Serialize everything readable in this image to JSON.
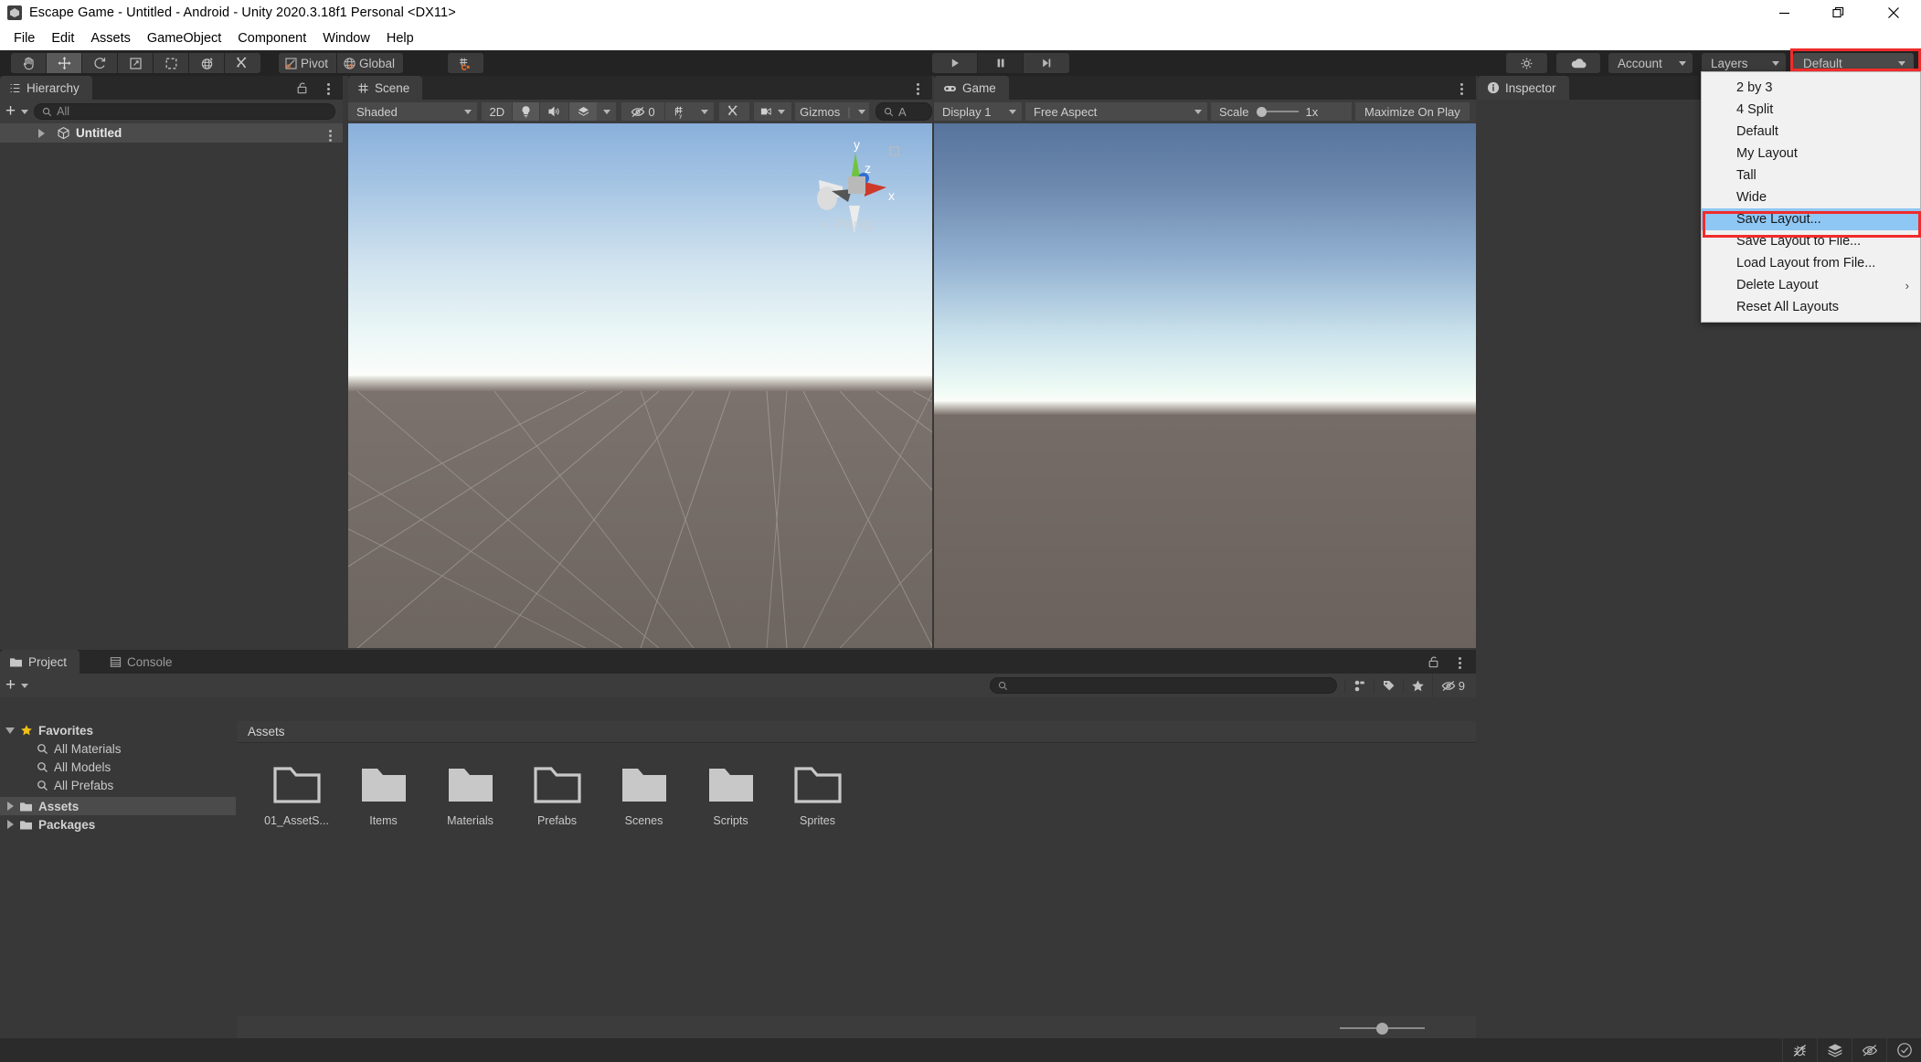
{
  "window": {
    "title": "Escape Game - Untitled - Android - Unity 2020.3.18f1 Personal <DX11>",
    "minimize": "minimize",
    "restore": "restore",
    "close": "close"
  },
  "menubar": {
    "items": [
      "File",
      "Edit",
      "Assets",
      "GameObject",
      "Component",
      "Window",
      "Help"
    ]
  },
  "toolbar": {
    "transform_tools": [
      "hand-tool",
      "move-tool",
      "rotate-tool",
      "scale-tool",
      "rect-tool",
      "transform-tool",
      "custom-tool"
    ],
    "pivot_label": "Pivot",
    "global_label": "Global",
    "snap_label": "grid-snap",
    "play_label": "play",
    "pause_label": "pause",
    "step_label": "step",
    "collab_label": "collab",
    "cloud_label": "cloud",
    "account_label": "Account",
    "layers_label": "Layers",
    "layout_label": "Default"
  },
  "hierarchy": {
    "tab": "Hierarchy",
    "search_placeholder": "All",
    "add_label": "+",
    "lock_label": "lock",
    "rows": [
      {
        "label": "Untitled",
        "icon": "unity-scene-icon"
      }
    ]
  },
  "scene": {
    "tab": "Scene",
    "shading_mode": "Shaded",
    "mode_2d": "2D",
    "lighting": "lighting-toggle",
    "audio": "audio-toggle",
    "fx": "effects-toggle",
    "hidden_count": "0",
    "grid": "grid-visibility",
    "tools": "scene-tools",
    "camera": "scene-camera",
    "gizmos_label": "Gizmos",
    "search_placeholder": "A",
    "gizmo": {
      "x": "x",
      "y": "y",
      "z": "z",
      "persp": "Persp"
    }
  },
  "game": {
    "tab": "Game",
    "display": "Display 1",
    "aspect": "Free Aspect",
    "scale_label": "Scale",
    "scale_value": "1x",
    "maximize_label": "Maximize On Play"
  },
  "inspector": {
    "tab": "Inspector"
  },
  "project": {
    "tab": "Project",
    "console_tab": "Console",
    "add_label": "+",
    "search_placeholder": "",
    "hidden_count": "9",
    "tree": [
      {
        "label": "Favorites",
        "type": "favorites",
        "expanded": true
      },
      {
        "label": "All Materials",
        "type": "search"
      },
      {
        "label": "All Models",
        "type": "search"
      },
      {
        "label": "All Prefabs",
        "type": "search"
      },
      {
        "label": "Assets",
        "type": "folder",
        "selected": true
      },
      {
        "label": "Packages",
        "type": "folder"
      }
    ],
    "breadcrumb": "Assets",
    "folders": [
      "01_AssetS...",
      "Items",
      "Materials",
      "Prefabs",
      "Scenes",
      "Scripts",
      "Sprites"
    ]
  },
  "layout_menu": {
    "items": [
      {
        "label": "2 by 3"
      },
      {
        "label": "4 Split"
      },
      {
        "label": "Default"
      },
      {
        "label": "My Layout"
      },
      {
        "label": "Tall"
      },
      {
        "label": "Wide"
      },
      {
        "label": "Save Layout...",
        "highlighted": true
      },
      {
        "label": "Save Layout to File..."
      },
      {
        "label": "Load Layout from File..."
      },
      {
        "label": "Delete Layout",
        "submenu": "›"
      },
      {
        "label": "Reset All Layouts"
      }
    ]
  },
  "statusbar": {
    "buttons": [
      "bug-icon",
      "layers-stack-icon",
      "eye-off-icon",
      "check-circle-icon"
    ]
  },
  "colors": {
    "accent_red": "#f12b2b",
    "menu_highlight": "#8ec6f4",
    "panel_bg": "#383838",
    "toolbar_bg": "#232323",
    "tab_active": "#3c3c3c"
  }
}
